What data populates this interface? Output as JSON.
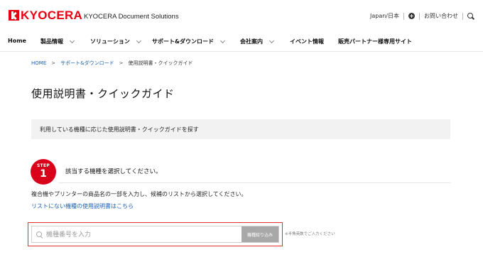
{
  "header": {
    "logo_text": "KYOCERA",
    "division": "KYOCERA Document Solutions",
    "language": "Japan/日本",
    "contact": "お問い合わせ",
    "icons": {
      "logo": "kyocera-logo-icon",
      "add": "plus-circle-icon",
      "search": "search-icon"
    },
    "brand_color": "#e60012"
  },
  "nav": {
    "items": [
      {
        "label": "Home",
        "dropdown": false
      },
      {
        "label": "製品情報",
        "dropdown": true
      },
      {
        "label": "ソリューション",
        "dropdown": true
      },
      {
        "label": "サポート&ダウンロード",
        "dropdown": true
      },
      {
        "label": "会社案内",
        "dropdown": true
      },
      {
        "label": "イベント情報",
        "dropdown": false
      },
      {
        "label": "販売パートナー様専用サイト",
        "dropdown": false
      }
    ]
  },
  "breadcrumb": {
    "home": "HOME",
    "support": "サポート&ダウンロード",
    "current": "使用説明書・クイックガイド",
    "separator": ">"
  },
  "page": {
    "title": "使用説明書・クイックガイド",
    "info": "利用している機種に応じた使用説明書・クイックガイドを探す"
  },
  "step": {
    "badge_label": "STEP",
    "badge_number": "1",
    "title": "該当する機種を選択してください。",
    "description": "複合機やプリンターの商品名の一部を入力し、候補のリストから選択してください。",
    "link": "リストにない機種の使用説明書はこちら",
    "accent_color": "#d9001b"
  },
  "search": {
    "placeholder": "機種番号を入力",
    "value": "",
    "button_label": "機種絞り込み",
    "note": "※半角英数でご入力ください"
  }
}
